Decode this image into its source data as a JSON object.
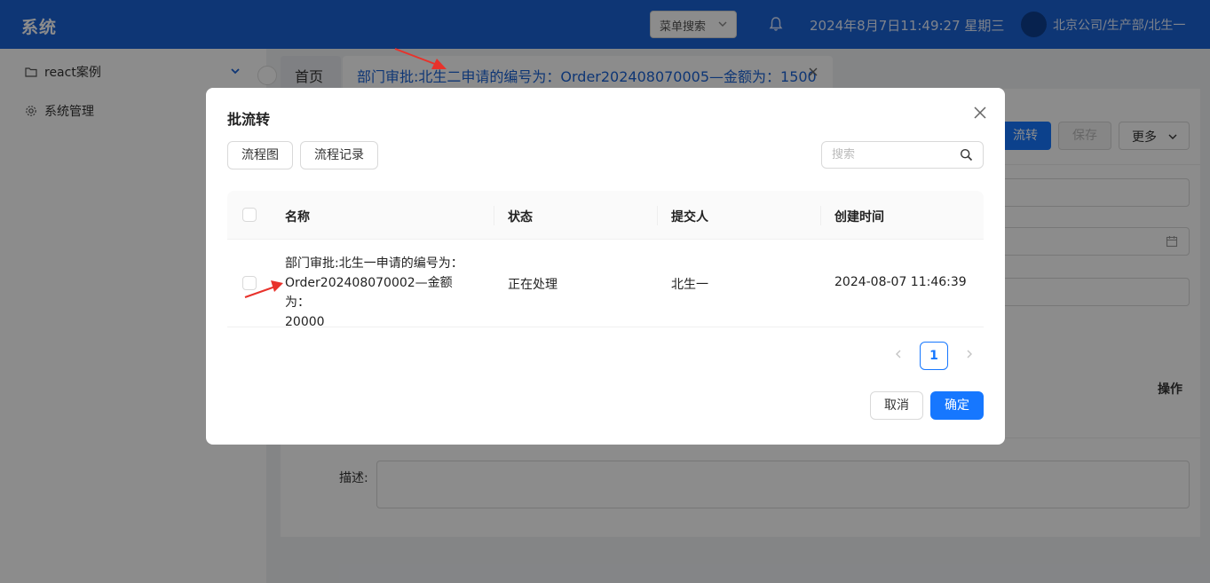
{
  "header": {
    "app_title": "系统",
    "menu_search_label": "菜单搜索",
    "datetime": "2024年8月7日11:49:27 星期三",
    "user_org": "北京公司/生产部/北生一"
  },
  "sidebar": {
    "items": [
      {
        "label": "react案例",
        "icon": "folder-icon"
      },
      {
        "label": "系统管理",
        "icon": "gear-icon"
      }
    ]
  },
  "tabs": [
    {
      "label": "首页"
    },
    {
      "label": "部门审批:北生二申请的编号为：Order202408070005—金额为：1500"
    }
  ],
  "toolbar": {
    "flow_label": "流转",
    "save_label": "保存",
    "more_label": "更多"
  },
  "form": {
    "operation_header": "操作",
    "description_label": "描述:"
  },
  "modal": {
    "title": "批流转",
    "flowchart_button": "流程图",
    "records_button": "流程记录",
    "search_placeholder": "搜索",
    "columns": [
      "名称",
      "状态",
      "提交人",
      "创建时间"
    ],
    "rows": [
      {
        "name_lines": [
          "部门审批:北生一申请的编号为：",
          "Order202408070002—金额为：",
          "20000"
        ],
        "status": "正在处理",
        "submitter": "北生一",
        "created": "2024-08-07 11:46:39"
      }
    ],
    "pagination": {
      "current_page": "1"
    },
    "cancel_label": "取消",
    "ok_label": "确定"
  },
  "colors": {
    "header_bg": "#1b63d6",
    "primary": "#1677ff",
    "annotation_arrow": "#e8322b"
  }
}
